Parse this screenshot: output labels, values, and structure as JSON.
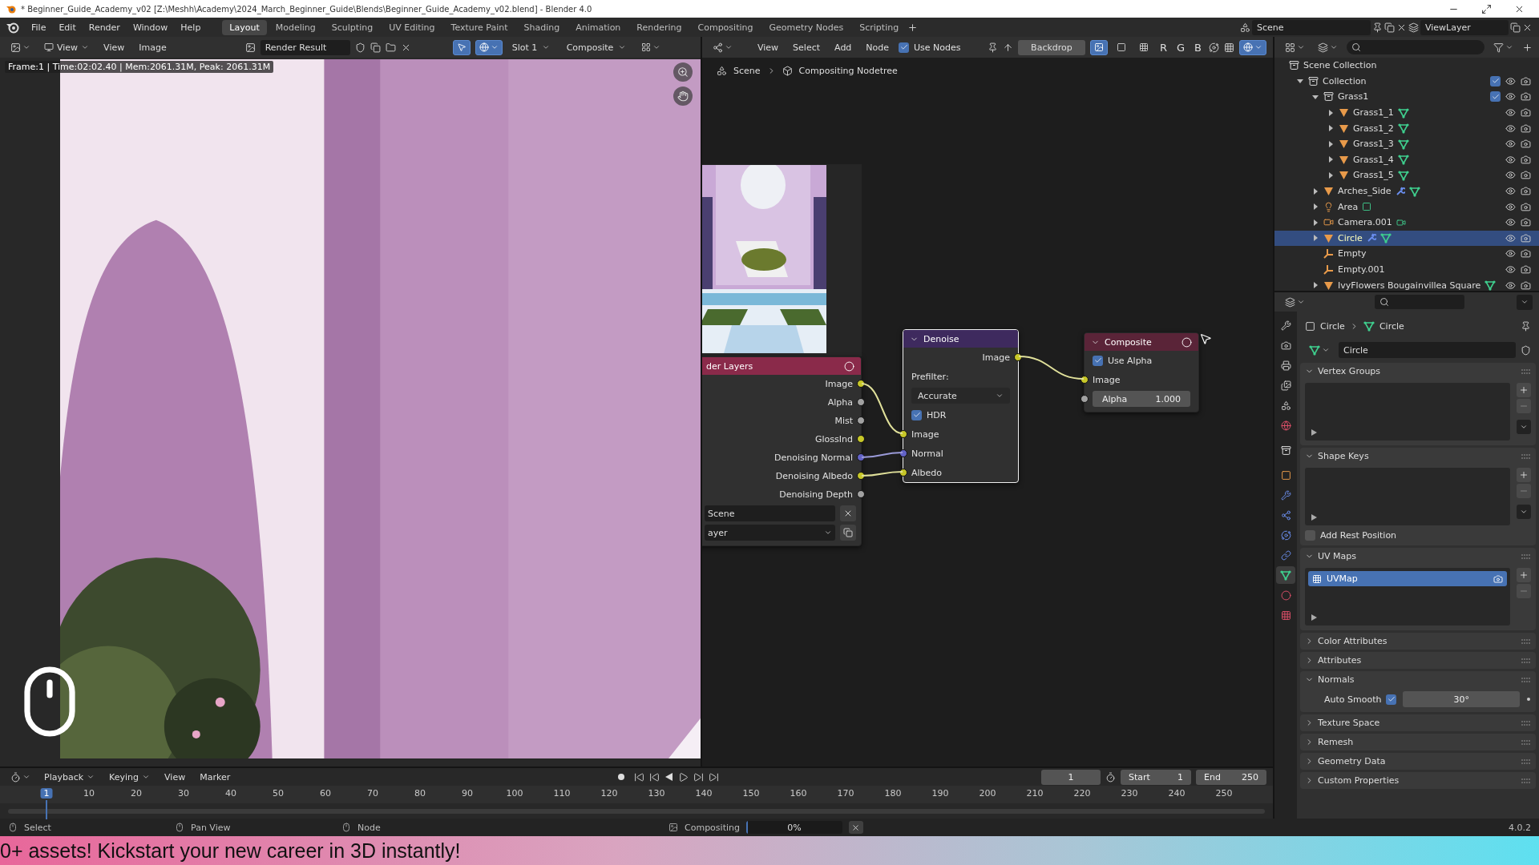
{
  "window": {
    "title": "* Beginner_Guide_Academy_v02 [Z:\\Meshh\\Academy\\2024_March_Beginner_Guide\\Blends\\Beginner_Guide_Academy_v02.blend] - Blender 4.0"
  },
  "menu": [
    "File",
    "Edit",
    "Render",
    "Window",
    "Help"
  ],
  "workspaces": [
    {
      "label": "Layout",
      "selected": true
    },
    {
      "label": "Modeling",
      "selected": false
    },
    {
      "label": "Sculpting",
      "selected": false
    },
    {
      "label": "UV Editing",
      "selected": false
    },
    {
      "label": "Texture Paint",
      "selected": false
    },
    {
      "label": "Shading",
      "selected": false
    },
    {
      "label": "Animation",
      "selected": false
    },
    {
      "label": "Rendering",
      "selected": false
    },
    {
      "label": "Compositing",
      "selected": false
    },
    {
      "label": "Geometry Nodes",
      "selected": false
    },
    {
      "label": "Scripting",
      "selected": false
    }
  ],
  "scene": "Scene",
  "view_layer": "ViewLayer",
  "image_editor": {
    "view_menu": "View",
    "menus": [
      "View",
      "Image"
    ],
    "image": "Render Result",
    "gizmos_on": true,
    "overlays_on": true,
    "slot": "Slot 1",
    "layer": "Composite",
    "overlay": "Frame:1 | Time:02:02.40 | Mem:2061.31M, Peak: 2061.31M"
  },
  "node_editor": {
    "menus": [
      "View",
      "Select",
      "Add",
      "Node"
    ],
    "use_nodes": {
      "label": "Use Nodes",
      "checked": true
    },
    "backdrop": "Backdrop",
    "display_modes": [
      {
        "kind": "color_alpha",
        "selected": true
      },
      {
        "kind": "color",
        "selected": false
      },
      {
        "kind": "alpha",
        "selected": false
      }
    ],
    "channels": [
      "R",
      "G",
      "B"
    ],
    "overlays_on": true,
    "breadcrumb": [
      "Scene",
      "Compositing Nodetree"
    ],
    "render_layers": {
      "title": "der Layers",
      "outputs": [
        {
          "label": "Image",
          "color": "#c7c729"
        },
        {
          "label": "Alpha",
          "color": "#a1a1a1"
        },
        {
          "label": "Mist",
          "color": "#a1a1a1"
        },
        {
          "label": "GlossInd",
          "color": "#c7c729"
        },
        {
          "label": "Denoising Normal",
          "color": "#6363c7"
        },
        {
          "label": "Denoising Albedo",
          "color": "#c7c729"
        },
        {
          "label": "Denoising Depth",
          "color": "#a1a1a1"
        }
      ],
      "scene": "Scene",
      "layer": "ayer"
    },
    "denoise": {
      "title": "Denoise",
      "output": "Image",
      "prefilter_label": "Prefilter:",
      "prefilter": "Accurate",
      "hdr": {
        "label": "HDR",
        "checked": true
      },
      "inputs": [
        {
          "label": "Image",
          "color": "#c7c729"
        },
        {
          "label": "Normal",
          "color": "#6363c7"
        },
        {
          "label": "Albedo",
          "color": "#c7c729"
        }
      ]
    },
    "composite": {
      "title": "Composite",
      "use_alpha": {
        "label": "Use Alpha",
        "checked": true
      },
      "input": "Image",
      "alpha_label": "Alpha",
      "alpha": "1.000"
    }
  },
  "outliner": {
    "root": "Scene Collection",
    "items": [
      {
        "name": "Collection",
        "kind": "collection",
        "checked": true,
        "expanded": true,
        "selected": false,
        "children": [
          {
            "name": "Grass1",
            "kind": "collection",
            "checked": true,
            "expanded": true,
            "selected": false,
            "children": [
              {
                "name": "Grass1_1",
                "kind": "mesh",
                "expanded": false,
                "modifier": false,
                "selected": false
              },
              {
                "name": "Grass1_2",
                "kind": "mesh",
                "expanded": false,
                "modifier": false,
                "selected": false
              },
              {
                "name": "Grass1_3",
                "kind": "mesh",
                "expanded": false,
                "modifier": false,
                "selected": false
              },
              {
                "name": "Grass1_4",
                "kind": "mesh",
                "expanded": false,
                "modifier": false,
                "selected": false
              },
              {
                "name": "Grass1_5",
                "kind": "mesh",
                "expanded": false,
                "modifier": false,
                "selected": false
              }
            ]
          },
          {
            "name": "Arches_Side",
            "kind": "mesh",
            "expanded": false,
            "modifier": true,
            "selected": false
          },
          {
            "name": "Area",
            "kind": "light",
            "expanded": false,
            "modifier": false,
            "selected": false
          },
          {
            "name": "Camera.001",
            "kind": "camera",
            "expanded": false,
            "modifier": false,
            "selected": false
          },
          {
            "name": "Circle",
            "kind": "mesh",
            "expanded": false,
            "modifier": true,
            "selected": true
          },
          {
            "name": "Empty",
            "kind": "empty",
            "modifier": false,
            "selected": false
          },
          {
            "name": "Empty.001",
            "kind": "empty",
            "modifier": false,
            "selected": false
          },
          {
            "name": "IvyFlowers Bougainvillea Square",
            "kind": "mesh",
            "expanded": false,
            "modifier": false,
            "selected": false
          }
        ]
      }
    ]
  },
  "properties": {
    "tabs": [
      {
        "kind": "tool",
        "selected": false
      },
      {
        "kind": "render",
        "selected": false
      },
      {
        "kind": "output",
        "selected": false
      },
      {
        "kind": "view_layer",
        "selected": false
      },
      {
        "kind": "scene",
        "selected": false
      },
      {
        "kind": "world",
        "selected": false
      },
      {
        "kind": "collection",
        "selected": false
      },
      {
        "kind": "object",
        "selected": false
      },
      {
        "kind": "modifier",
        "selected": false
      },
      {
        "kind": "particles",
        "selected": false
      },
      {
        "kind": "physics",
        "selected": false
      },
      {
        "kind": "constraints",
        "selected": false
      },
      {
        "kind": "data",
        "selected": true
      },
      {
        "kind": "material",
        "selected": false
      },
      {
        "kind": "texture",
        "selected": false
      }
    ],
    "breadcrumb": [
      "Circle",
      "Circle"
    ],
    "data_name": "Circle",
    "panels": [
      {
        "title": "Vertex Groups",
        "expanded": true,
        "kind": "list"
      },
      {
        "title": "Shape Keys",
        "expanded": true,
        "kind": "list",
        "option": {
          "label": "Add Rest Position",
          "checked": false
        }
      },
      {
        "title": "UV Maps",
        "expanded": true,
        "kind": "list",
        "items": [
          {
            "label": "UVMap",
            "selected": true
          }
        ]
      },
      {
        "title": "Color Attributes",
        "expanded": false
      },
      {
        "title": "Attributes",
        "expanded": false
      },
      {
        "title": "Normals",
        "expanded": true,
        "kind": "normals",
        "auto_smooth": {
          "label": "Auto Smooth",
          "checked": true,
          "value": "30°"
        }
      },
      {
        "title": "Texture Space",
        "expanded": false
      },
      {
        "title": "Remesh",
        "expanded": false
      },
      {
        "title": "Geometry Data",
        "expanded": false
      },
      {
        "title": "Custom Properties",
        "expanded": false
      }
    ]
  },
  "timeline": {
    "menus": [
      "Playback",
      "Keying",
      "View",
      "Marker"
    ],
    "current_frame": "1",
    "start_label": "Start",
    "start": "1",
    "end_label": "End",
    "end": "250",
    "ticks": [
      {
        "label": "1",
        "selected": true
      },
      {
        "label": "10",
        "selected": false
      },
      {
        "label": "20",
        "selected": false
      },
      {
        "label": "30",
        "selected": false
      },
      {
        "label": "40",
        "selected": false
      },
      {
        "label": "50",
        "selected": false
      },
      {
        "label": "60",
        "selected": false
      },
      {
        "label": "70",
        "selected": false
      },
      {
        "label": "80",
        "selected": false
      },
      {
        "label": "90",
        "selected": false
      },
      {
        "label": "100",
        "selected": false
      },
      {
        "label": "110",
        "selected": false
      },
      {
        "label": "120",
        "selected": false
      },
      {
        "label": "130",
        "selected": false
      },
      {
        "label": "140",
        "selected": false
      },
      {
        "label": "150",
        "selected": false
      },
      {
        "label": "160",
        "selected": false
      },
      {
        "label": "170",
        "selected": false
      },
      {
        "label": "180",
        "selected": false
      },
      {
        "label": "190",
        "selected": false
      },
      {
        "label": "200",
        "selected": false
      },
      {
        "label": "210",
        "selected": false
      },
      {
        "label": "220",
        "selected": false
      },
      {
        "label": "230",
        "selected": false
      },
      {
        "label": "240",
        "selected": false
      },
      {
        "label": "250",
        "selected": false
      }
    ]
  },
  "status_bar": {
    "hints": [
      "Select",
      "Pan View",
      "Node"
    ],
    "job": "Compositing",
    "progress": "0%",
    "level": 0.02,
    "version": "4.0.2"
  },
  "banner": "0+ assets! Kickstart your new career in 3D instantly!"
}
